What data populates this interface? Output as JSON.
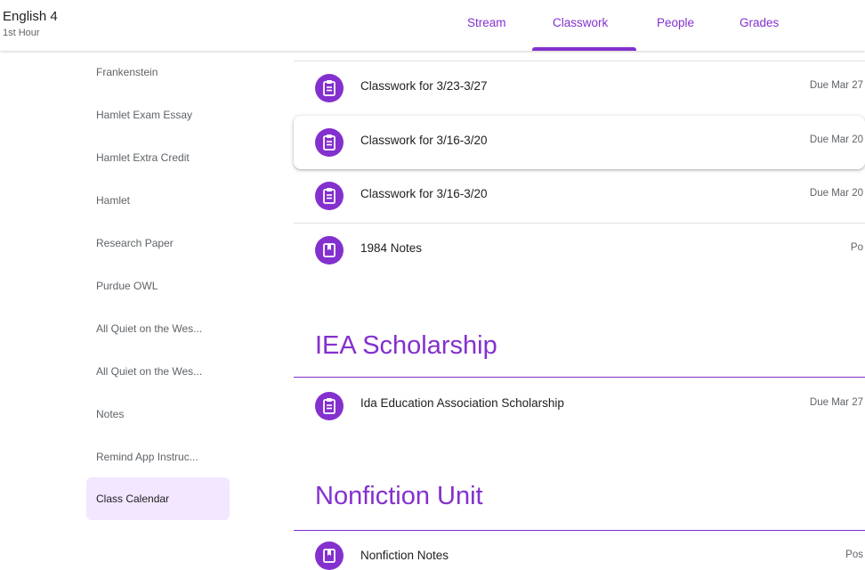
{
  "header": {
    "class_name": "English 4",
    "class_period": "1st Hour",
    "tabs": [
      {
        "label": "Stream"
      },
      {
        "label": "Classwork"
      },
      {
        "label": "People"
      },
      {
        "label": "Grades"
      }
    ],
    "active_tab": "Classwork"
  },
  "colors": {
    "accent": "#8430ce",
    "active_item_bg": "#f2e7fe"
  },
  "sidebar": {
    "items": [
      {
        "label": "Frankenstein"
      },
      {
        "label": "Hamlet Exam Essay"
      },
      {
        "label": "Hamlet Extra Credit"
      },
      {
        "label": "Hamlet"
      },
      {
        "label": "Research Paper"
      },
      {
        "label": "Purdue OWL"
      },
      {
        "label": "All Quiet on the Wes..."
      },
      {
        "label": "All Quiet on the Wes..."
      },
      {
        "label": "Notes"
      },
      {
        "label": "Remind App Instruc..."
      },
      {
        "label": "Class Calendar"
      }
    ],
    "active_item": "Class Calendar"
  },
  "main": {
    "items": [
      {
        "icon": "assignment-icon",
        "title": "Classwork for 3/23-3/27",
        "due": "Due Mar 27"
      },
      {
        "icon": "assignment-icon",
        "title": "Classwork for 3/16-3/20",
        "due": "Due Mar 20"
      },
      {
        "icon": "assignment-icon",
        "title": "Classwork for 3/16-3/20",
        "due": "Due Mar 20"
      },
      {
        "icon": "material-icon",
        "title": "1984 Notes",
        "due": "Po"
      }
    ],
    "sections": [
      {
        "title": "IEA Scholarship",
        "items": [
          {
            "icon": "assignment-icon",
            "title": "Ida Education Association Scholarship",
            "due": "Due Mar 27"
          }
        ]
      },
      {
        "title": "Nonfiction Unit",
        "items": [
          {
            "icon": "material-icon",
            "title": "Nonfiction Notes",
            "due": "Pos"
          }
        ]
      }
    ]
  }
}
